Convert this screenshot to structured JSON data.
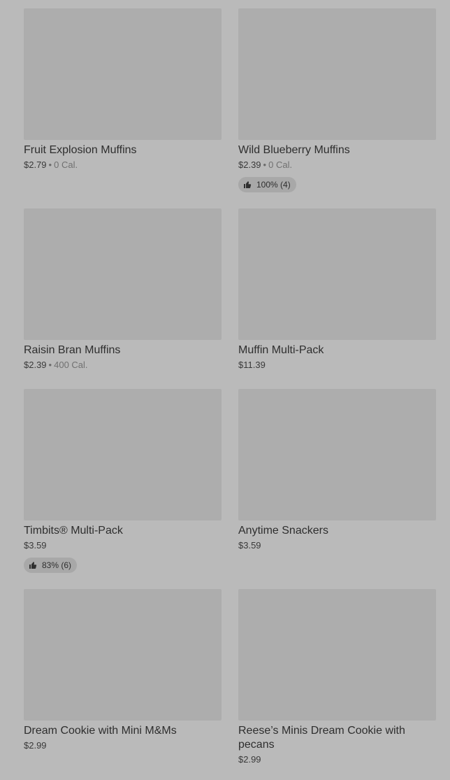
{
  "items": [
    {
      "name": "Fruit Explosion Muffins",
      "price": "$2.79",
      "calories": "0 Cal.",
      "rating": ""
    },
    {
      "name": "Wild Blueberry Muffins",
      "price": "$2.39",
      "calories": "0 Cal.",
      "rating": "100% (4)"
    },
    {
      "name": "Raisin Bran Muffins",
      "price": "$2.39",
      "calories": "400 Cal.",
      "rating": ""
    },
    {
      "name": "Muffin Multi-Pack",
      "price": "$11.39",
      "calories": "",
      "rating": ""
    },
    {
      "name": "Timbits® Multi-Pack",
      "price": "$3.59",
      "calories": "",
      "rating": "83% (6)"
    },
    {
      "name": "Anytime Snackers",
      "price": "$3.59",
      "calories": "",
      "rating": ""
    },
    {
      "name": "Dream Cookie with Mini M&Ms",
      "price": "$2.99",
      "calories": "",
      "rating": ""
    },
    {
      "name": "Reese’s Minis Dream Cookie with pecans",
      "price": "$2.99",
      "calories": "",
      "rating": ""
    }
  ],
  "icons": {
    "rating": "thumbs-up-icon"
  },
  "colors": {
    "background": "#bababa",
    "image_placeholder": "#adadad",
    "badge": "#a8a8a8"
  }
}
